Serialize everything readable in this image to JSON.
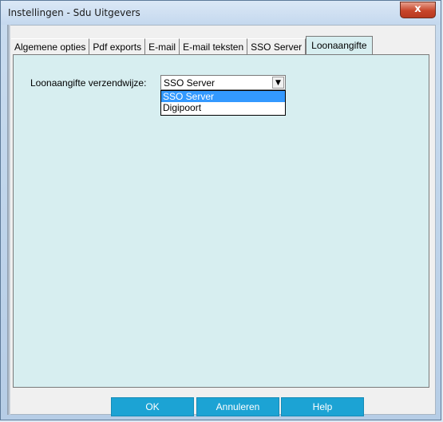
{
  "window": {
    "title": "Instellingen - Sdu Uitgevers",
    "close_label": "x"
  },
  "tabs": [
    {
      "label": "Algemene opties"
    },
    {
      "label": "Pdf exports"
    },
    {
      "label": "E-mail"
    },
    {
      "label": "E-mail teksten"
    },
    {
      "label": "SSO Server"
    },
    {
      "label": "Loonaangifte"
    }
  ],
  "active_tab": "Loonaangifte",
  "form": {
    "label": "Loonaangifte verzendwijze:",
    "combo_value": "SSO Server",
    "options": [
      {
        "label": "SSO Server",
        "selected": true
      },
      {
        "label": "Digipoort",
        "selected": false
      }
    ]
  },
  "buttons": {
    "ok": "OK",
    "cancel": "Annuleren",
    "help": "Help"
  },
  "colors": {
    "panel": "#d7eef0",
    "button": "#1ca3d4",
    "selection": "#3399ff"
  }
}
